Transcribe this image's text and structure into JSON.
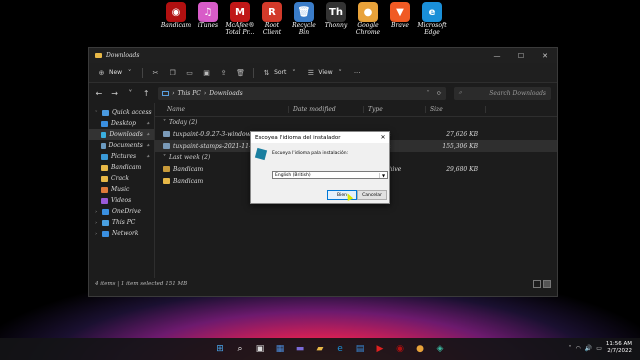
{
  "desktop": {
    "icons": [
      {
        "label": "Bandicam",
        "icon": "bandicam-icon",
        "glyph": "◉",
        "color": "#b21010"
      },
      {
        "label": "iTunes",
        "icon": "itunes-icon",
        "glyph": "♫",
        "color": "#d85cc8"
      },
      {
        "label": "McAfee® Total Pr...",
        "icon": "mcafee-icon",
        "glyph": "M",
        "color": "#c01818"
      },
      {
        "label": "Root Client",
        "icon": "root-client-icon",
        "glyph": "R",
        "color": "#d23a2a"
      },
      {
        "label": "Recycle Bin",
        "icon": "recycle-bin-icon",
        "glyph": "🗑",
        "color": "#3a7cc8"
      },
      {
        "label": "Thonny",
        "icon": "thonny-icon",
        "glyph": "Th",
        "color": "#333333"
      },
      {
        "label": "Google Chrome",
        "icon": "chrome-icon",
        "glyph": "●",
        "color": "#e8a23a"
      },
      {
        "label": "Brave",
        "icon": "brave-icon",
        "glyph": "▼",
        "color": "#f05a24"
      },
      {
        "label": "Microsoft Edge",
        "icon": "edge-icon",
        "glyph": "e",
        "color": "#1a8fd8"
      }
    ]
  },
  "window": {
    "title": "Downloads",
    "toolbar": {
      "new": "New",
      "sort": "Sort",
      "view": "View"
    },
    "address": {
      "path1": "This PC",
      "sep": "›",
      "path2": "Downloads"
    },
    "search_placeholder": "Search Downloads",
    "sidebar": [
      {
        "label": "Quick access",
        "icon": "star-icon",
        "color": "#4a9ae0",
        "chev": "˅",
        "indent": false
      },
      {
        "label": "Desktop",
        "icon": "desktop-folder-icon",
        "color": "#3a8fe0",
        "pin": "📌",
        "indent": true
      },
      {
        "label": "Downloads",
        "icon": "downloads-folder-icon",
        "color": "#3ab0e0",
        "pin": "📌",
        "indent": true,
        "selected": true
      },
      {
        "label": "Documents",
        "icon": "documents-folder-icon",
        "color": "#6a9ac0",
        "pin": "📌",
        "indent": true
      },
      {
        "label": "Pictures",
        "icon": "pictures-folder-icon",
        "color": "#3a9ad8",
        "pin": "📌",
        "indent": true
      },
      {
        "label": "Bandicam",
        "icon": "folder-icon",
        "color": "#e8b847",
        "indent": true
      },
      {
        "label": "Crack",
        "icon": "folder-icon",
        "color": "#e8b847",
        "indent": true
      },
      {
        "label": "Music",
        "icon": "music-folder-icon",
        "color": "#e07a3a",
        "indent": true
      },
      {
        "label": "Videos",
        "icon": "videos-folder-icon",
        "color": "#9a5ad8",
        "indent": true
      },
      {
        "label": "OneDrive",
        "icon": "onedrive-icon",
        "color": "#3a8fe0",
        "chev": "›",
        "indent": false
      },
      {
        "label": "This PC",
        "icon": "this-pc-icon",
        "color": "#4aa0e0",
        "chev": "›",
        "indent": false
      },
      {
        "label": "Network",
        "icon": "network-icon",
        "color": "#3a8fe0",
        "chev": "›",
        "indent": false
      }
    ],
    "columns": {
      "name": "Name",
      "date": "Date modified",
      "type": "Type",
      "size": "Size"
    },
    "groups": [
      {
        "header": "Today (2)",
        "rows": [
          {
            "name": "tuxpaint-0.9.27-3-windows-x8",
            "date": "",
            "type": "lication",
            "size": "27,626 KB",
            "icon": "installer-icon",
            "color": "#7a9ab8"
          },
          {
            "name": "tuxpaint-stamps-2021-11-25-",
            "date": "",
            "type": "lication",
            "size": "155,306 KB",
            "icon": "installer-icon",
            "color": "#7a9ab8",
            "selected": true
          }
        ]
      },
      {
        "header": "Last week (2)",
        "rows": [
          {
            "name": "Bandicam",
            "date": "",
            "type": "AR archive",
            "size": "29,680 KB",
            "icon": "archive-icon",
            "color": "#c89a3a"
          },
          {
            "name": "Bandicam",
            "date": "",
            "type": "folder",
            "size": "",
            "icon": "folder-icon",
            "color": "#e8b847"
          }
        ]
      }
    ],
    "status": "4 items | 1 item selected 151 MB"
  },
  "dialog": {
    "title": "Escoyea l'idioma del instalador",
    "prompt": "Escueya l'idioma pala instalación:",
    "selected_language": "English (British)",
    "ok_label": "Bien",
    "cancel_label": "Cancelar"
  },
  "taskbar": {
    "apps": [
      {
        "icon": "windows-start-icon",
        "glyph": "⊞",
        "color": "#4aa8f0"
      },
      {
        "icon": "search-icon",
        "glyph": "⌕",
        "color": "#ffffff"
      },
      {
        "icon": "task-view-icon",
        "glyph": "▣",
        "color": "#dddddd"
      },
      {
        "icon": "widgets-icon",
        "glyph": "▦",
        "color": "#4a8ad8"
      },
      {
        "icon": "chat-icon",
        "glyph": "▬",
        "color": "#7a6ad8"
      },
      {
        "icon": "file-explorer-icon",
        "glyph": "▰",
        "color": "#e8b847"
      },
      {
        "icon": "edge-icon",
        "glyph": "e",
        "color": "#1a8fd8"
      },
      {
        "icon": "store-icon",
        "glyph": "▤",
        "color": "#3a8fe0"
      },
      {
        "icon": "youtube-icon",
        "glyph": "▶",
        "color": "#e02020"
      },
      {
        "icon": "bandicam-icon",
        "glyph": "◉",
        "color": "#b21010"
      },
      {
        "icon": "chrome-icon",
        "glyph": "●",
        "color": "#e8a23a"
      },
      {
        "icon": "setup-icon",
        "glyph": "◈",
        "color": "#3ab8a0"
      }
    ],
    "time": "11:56 AM",
    "date": "2/7/2022"
  }
}
